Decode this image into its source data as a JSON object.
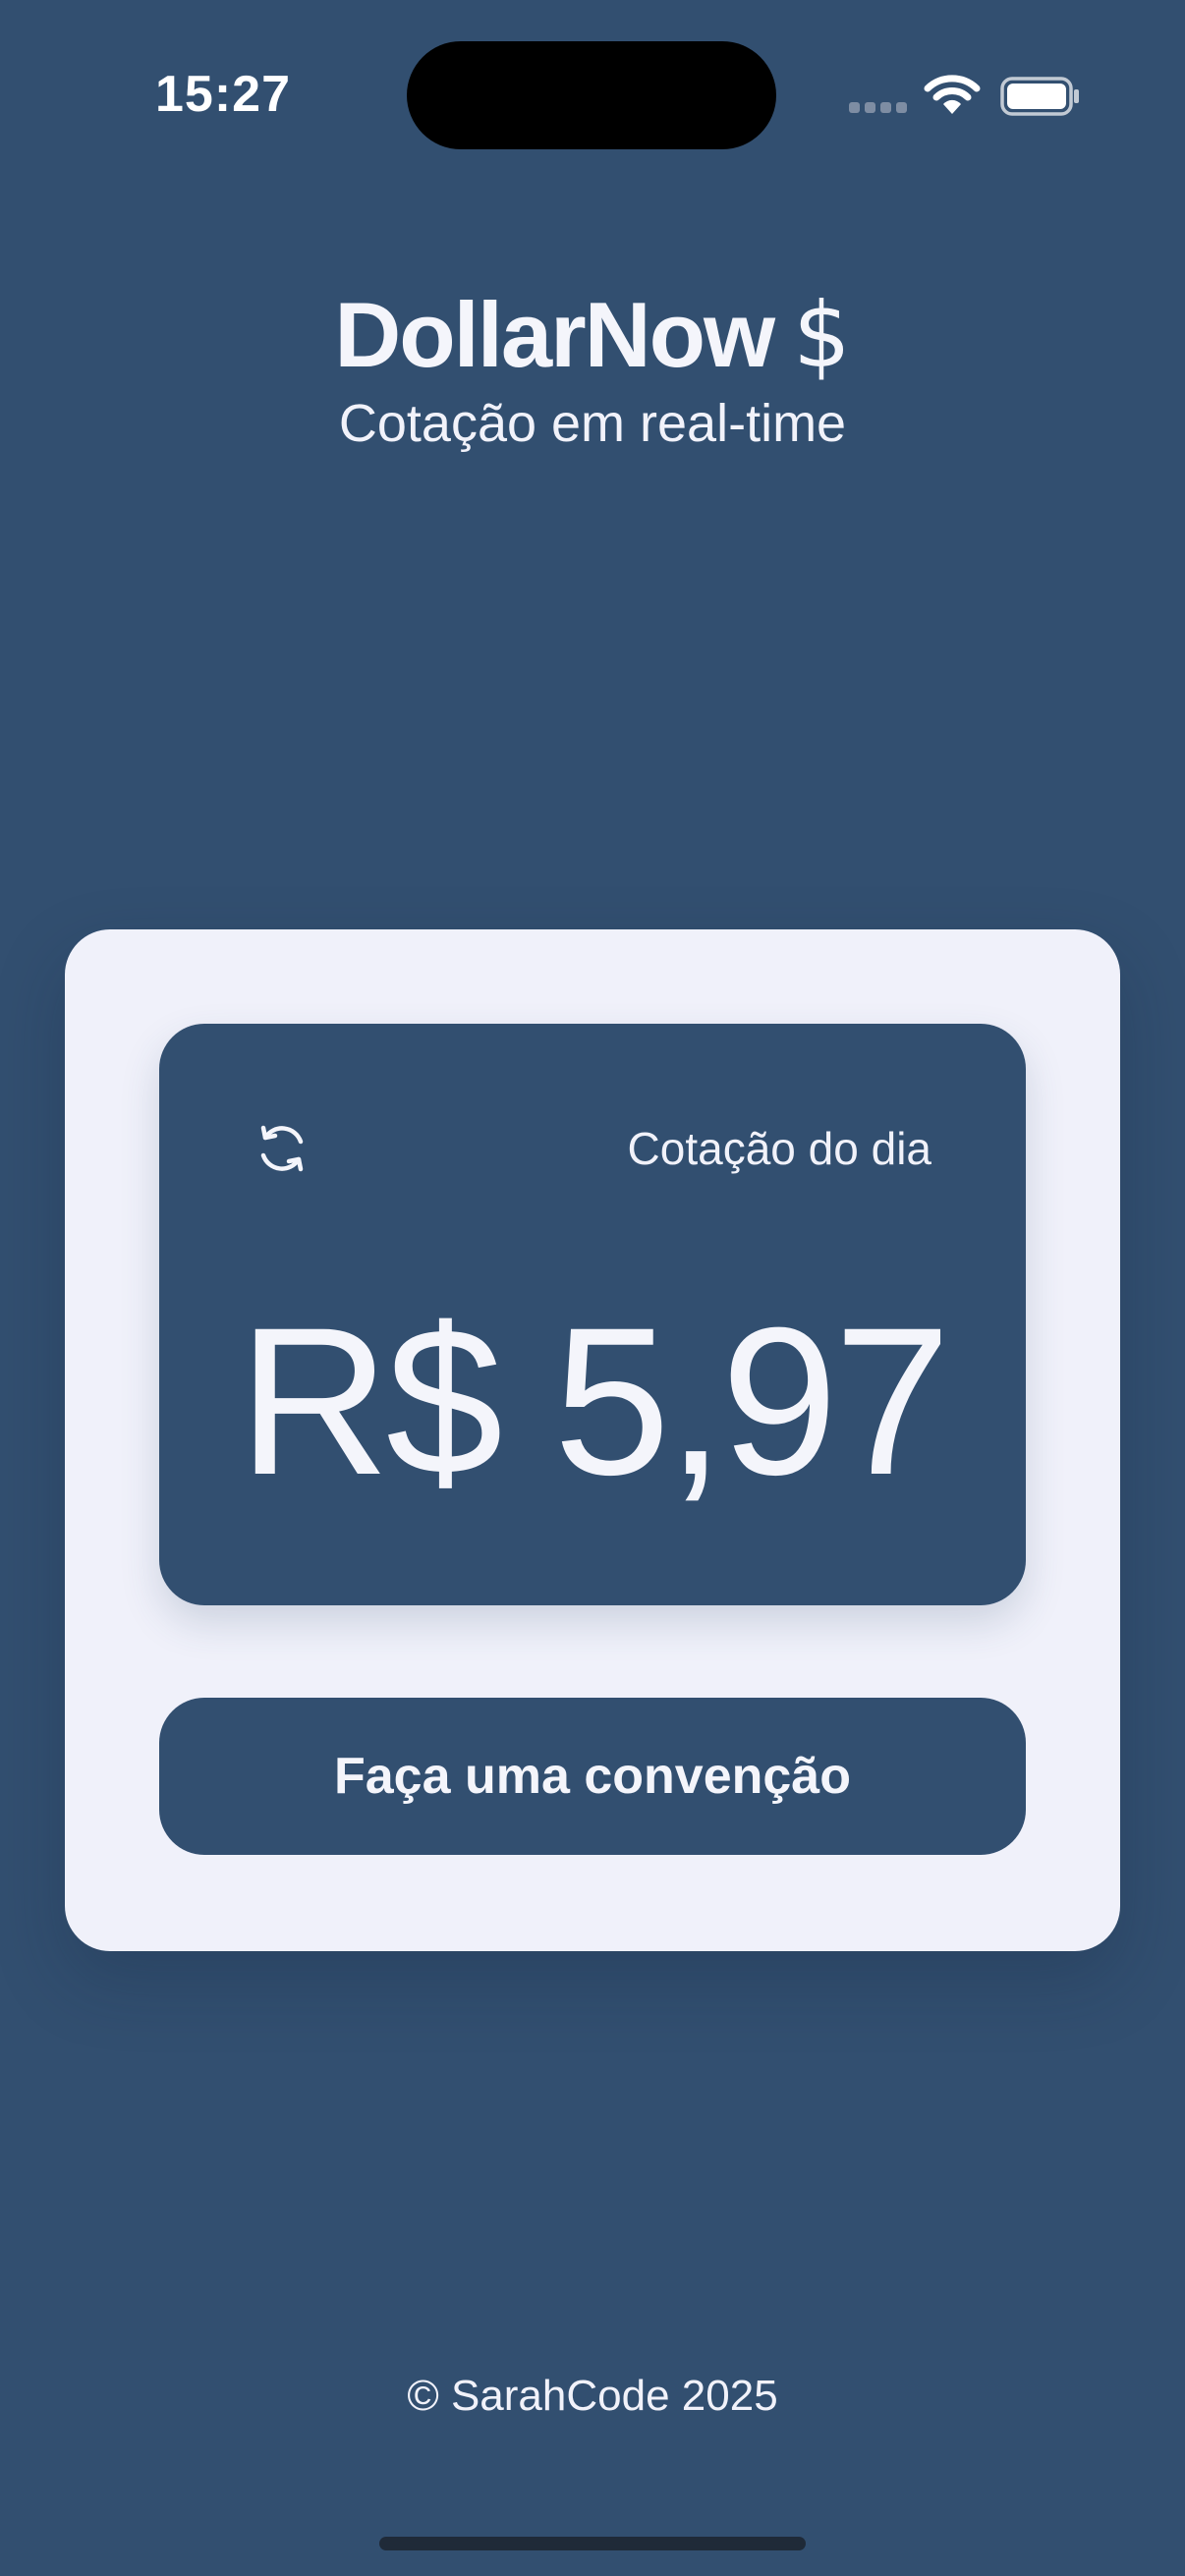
{
  "status_bar": {
    "time": "15:27"
  },
  "header": {
    "title": "DollarNow",
    "title_icon": "$",
    "subtitle": "Cotação em real-time"
  },
  "rate_card": {
    "refresh_icon": "refresh-icon",
    "label": "Cotação do dia",
    "value": "R$ 5,97"
  },
  "actions": {
    "convert_label": "Faça uma convenção"
  },
  "footer": {
    "copyright": "© SarahCode 2025"
  },
  "colors": {
    "background": "#324F70",
    "card_background": "#F0F1FA",
    "text_light": "#F4F5FB",
    "island": "#000000"
  }
}
